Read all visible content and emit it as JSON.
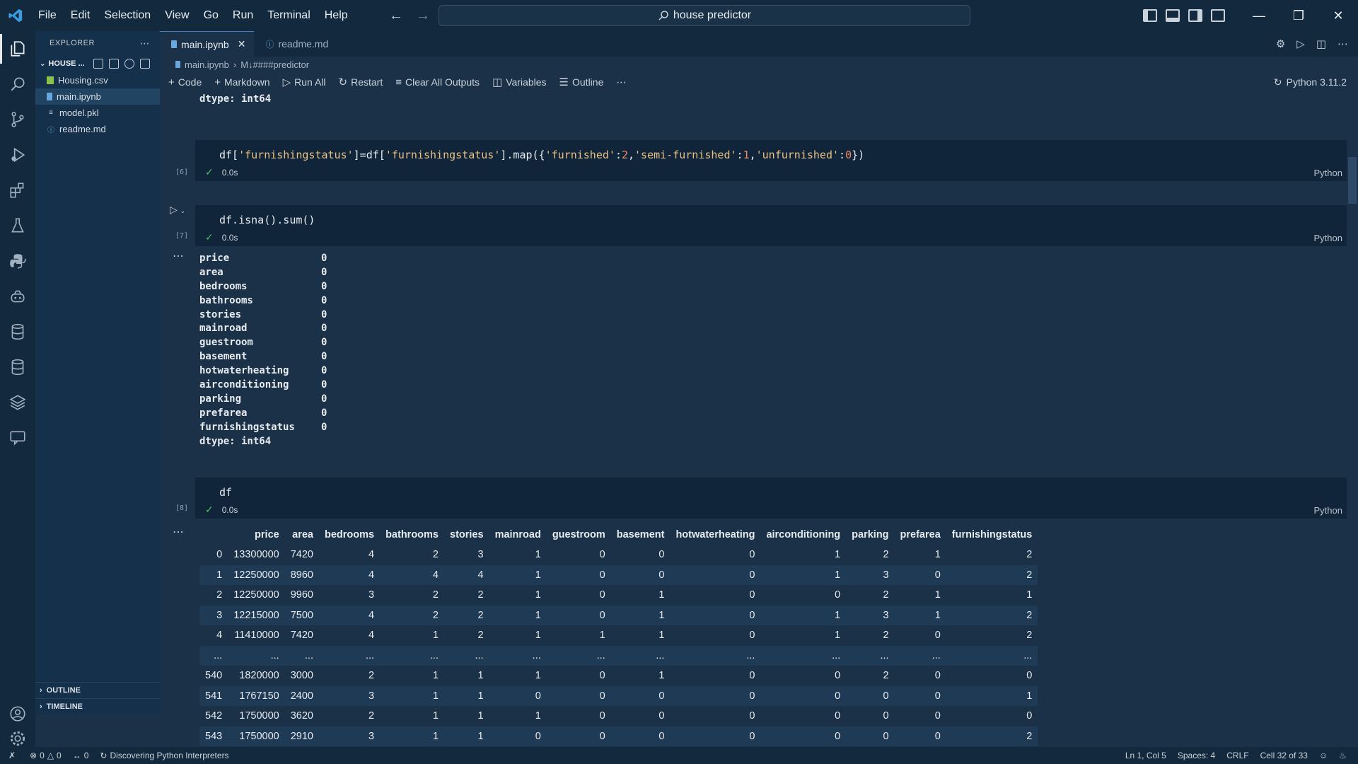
{
  "titlebar": {
    "menu": [
      "File",
      "Edit",
      "Selection",
      "View",
      "Go",
      "Run",
      "Terminal",
      "Help"
    ],
    "search_text": "house predictor"
  },
  "sidebar": {
    "header": "EXPLORER",
    "folder": "HOUSE ...",
    "files": [
      {
        "name": "Housing.csv",
        "icon": "csv-icon",
        "color": "#8bc34a"
      },
      {
        "name": "main.ipynb",
        "icon": "notebook-icon",
        "color": "#6aa7de"
      },
      {
        "name": "model.pkl",
        "icon": "file-lines-icon",
        "color": "#c4ccd5"
      },
      {
        "name": "readme.md",
        "icon": "info-icon",
        "color": "#6aa7de"
      }
    ],
    "outline_label": "OUTLINE",
    "timeline_label": "TIMELINE"
  },
  "tabs": [
    {
      "label": "main.ipynb",
      "active": true
    },
    {
      "label": "readme.md",
      "active": false
    }
  ],
  "breadcrumb": {
    "file": "main.ipynb",
    "section": "M↓####predictor"
  },
  "toolbar": {
    "code": "Code",
    "markdown": "Markdown",
    "run_all": "Run All",
    "restart": "Restart",
    "clear": "Clear All Outputs",
    "variables": "Variables",
    "outline": "Outline",
    "kernel": "Python 3.11.2"
  },
  "notebook": {
    "prev_output_tail": "dtype: int64",
    "cell6": {
      "count": "[6]",
      "time": "0.0s",
      "lang": "Python",
      "code_parts": {
        "a": "df[",
        "b": "'furnishingstatus'",
        "c": "]=df[",
        "d": "'furnishingstatus'",
        "e": "].map({",
        "f": "'furnished'",
        "g": ":",
        "h": "2",
        "i": ",",
        "j": "'semi-furnished'",
        "k": ":",
        "l": "1",
        "m": ",",
        "n": "'unfurnished'",
        "o": ":",
        "p": "0",
        "q": "})"
      }
    },
    "cell7": {
      "count": "[7]",
      "time": "0.0s",
      "lang": "Python",
      "code": "df.isna().sum()",
      "output": [
        [
          "price",
          "0"
        ],
        [
          "area",
          "0"
        ],
        [
          "bedrooms",
          "0"
        ],
        [
          "bathrooms",
          "0"
        ],
        [
          "stories",
          "0"
        ],
        [
          "mainroad",
          "0"
        ],
        [
          "guestroom",
          "0"
        ],
        [
          "basement",
          "0"
        ],
        [
          "hotwaterheating",
          "0"
        ],
        [
          "airconditioning",
          "0"
        ],
        [
          "parking",
          "0"
        ],
        [
          "prefarea",
          "0"
        ],
        [
          "furnishingstatus",
          "0"
        ]
      ],
      "dtype": "dtype: int64"
    },
    "cell8": {
      "count": "[8]",
      "time": "0.0s",
      "lang": "Python",
      "code": "df",
      "table": {
        "columns": [
          "",
          "price",
          "area",
          "bedrooms",
          "bathrooms",
          "stories",
          "mainroad",
          "guestroom",
          "basement",
          "hotwaterheating",
          "airconditioning",
          "parking",
          "prefarea",
          "furnishingstatus"
        ],
        "rows": [
          [
            "0",
            "13300000",
            "7420",
            "4",
            "2",
            "3",
            "1",
            "0",
            "0",
            "0",
            "1",
            "2",
            "1",
            "2"
          ],
          [
            "1",
            "12250000",
            "8960",
            "4",
            "4",
            "4",
            "1",
            "0",
            "0",
            "0",
            "1",
            "3",
            "0",
            "2"
          ],
          [
            "2",
            "12250000",
            "9960",
            "3",
            "2",
            "2",
            "1",
            "0",
            "1",
            "0",
            "0",
            "2",
            "1",
            "1"
          ],
          [
            "3",
            "12215000",
            "7500",
            "4",
            "2",
            "2",
            "1",
            "0",
            "1",
            "0",
            "1",
            "3",
            "1",
            "2"
          ],
          [
            "4",
            "11410000",
            "7420",
            "4",
            "1",
            "2",
            "1",
            "1",
            "1",
            "0",
            "1",
            "2",
            "0",
            "2"
          ],
          [
            "...",
            "...",
            "...",
            "...",
            "...",
            "...",
            "...",
            "...",
            "...",
            "...",
            "...",
            "...",
            "...",
            "..."
          ],
          [
            "540",
            "1820000",
            "3000",
            "2",
            "1",
            "1",
            "1",
            "0",
            "1",
            "0",
            "0",
            "2",
            "0",
            "0"
          ],
          [
            "541",
            "1767150",
            "2400",
            "3",
            "1",
            "1",
            "0",
            "0",
            "0",
            "0",
            "0",
            "0",
            "0",
            "1"
          ],
          [
            "542",
            "1750000",
            "3620",
            "2",
            "1",
            "1",
            "1",
            "0",
            "0",
            "0",
            "0",
            "0",
            "0",
            "0"
          ],
          [
            "543",
            "1750000",
            "2910",
            "3",
            "1",
            "1",
            "0",
            "0",
            "0",
            "0",
            "0",
            "0",
            "0",
            "2"
          ]
        ]
      }
    }
  },
  "statusbar": {
    "errors": "0",
    "warnings": "0",
    "ports": "0",
    "discovering": "Discovering Python Interpreters",
    "position": "Ln 1, Col 5",
    "spaces": "Spaces: 4",
    "eol": "CRLF",
    "cell": "Cell 32 of 33"
  }
}
